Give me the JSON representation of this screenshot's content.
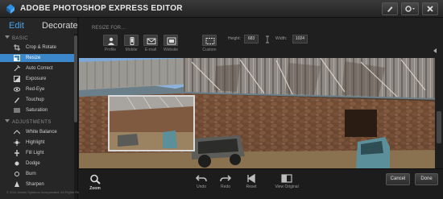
{
  "app": {
    "title": "ADOBE PHOTOSHOP EXPRESS EDITOR"
  },
  "sidebar": {
    "tabs": [
      {
        "label": "Edit",
        "active": true
      },
      {
        "label": "Decorate",
        "active": false
      }
    ],
    "sections": [
      {
        "title": "BASIC"
      },
      {
        "title": "ADJUSTMENTS"
      }
    ],
    "basic_items": [
      {
        "label": "Crop & Rotate",
        "icon": "crop-icon"
      },
      {
        "label": "Resize",
        "icon": "resize-icon",
        "selected": true
      },
      {
        "label": "Auto Correct",
        "icon": "auto-correct-icon"
      },
      {
        "label": "Exposure",
        "icon": "exposure-icon"
      },
      {
        "label": "Red-Eye",
        "icon": "eye-icon"
      },
      {
        "label": "Touchup",
        "icon": "brush-icon"
      },
      {
        "label": "Saturation",
        "icon": "saturation-icon"
      }
    ],
    "adjustment_items": [
      {
        "label": "White Balance",
        "icon": "white-balance-icon"
      },
      {
        "label": "Highlight",
        "icon": "highlight-icon"
      },
      {
        "label": "Fill Light",
        "icon": "fill-light-icon"
      },
      {
        "label": "Dodge",
        "icon": "dodge-icon"
      },
      {
        "label": "Burn",
        "icon": "burn-icon"
      },
      {
        "label": "Sharpen",
        "icon": "sharpen-icon"
      }
    ],
    "footer": "© 2011 Adobe Systems Incorporated. All Rights Reserved.  Terms of Use  |  Privacy Policy"
  },
  "options": {
    "heading": "RESIZE FOR...",
    "presets": [
      {
        "label": "Profile",
        "icon": "person-icon"
      },
      {
        "label": "Mobile",
        "icon": "mobile-icon"
      },
      {
        "label": "E-mail",
        "icon": "email-icon"
      },
      {
        "label": "Website",
        "icon": "website-icon"
      },
      {
        "label": "Custom",
        "icon": "custom-size-icon"
      }
    ],
    "height_label": "Height:",
    "height_value": "683",
    "width_label": "Width:",
    "width_value": "1024"
  },
  "bottom": {
    "zoom_label": "Zoom",
    "undo_label": "Undo",
    "redo_label": "Redo",
    "reset_label": "Reset",
    "view_original_label": "View Original",
    "cancel_label": "Cancel",
    "done_label": "Done"
  },
  "colors": {
    "accent": "#3b87c9",
    "tab_active": "#4aa3e8"
  }
}
